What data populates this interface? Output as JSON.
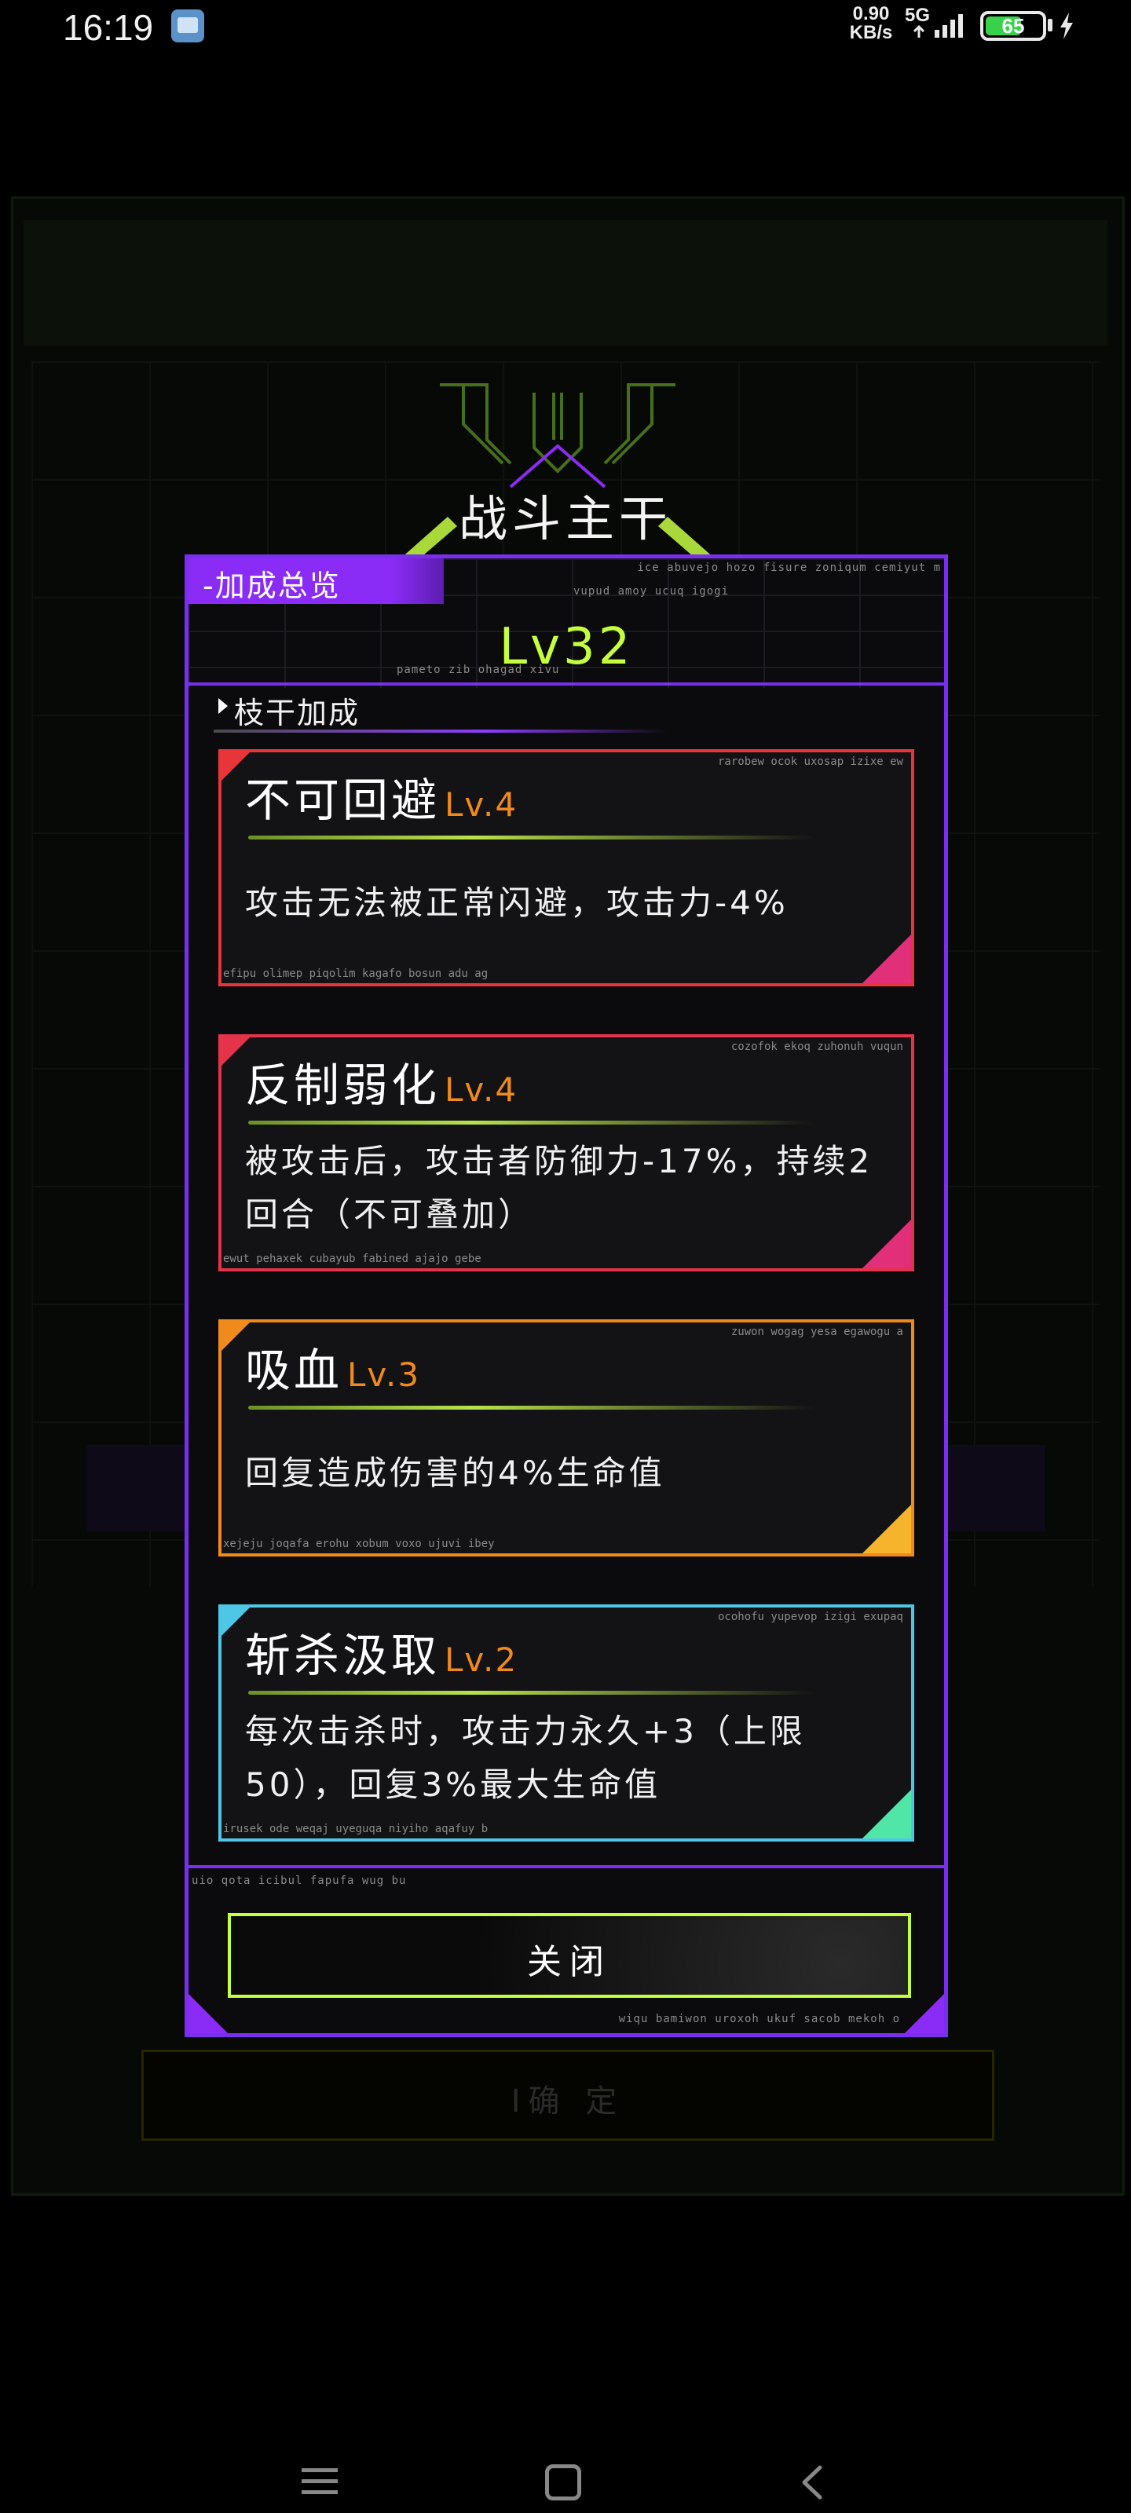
{
  "status_bar": {
    "time": "16:19",
    "net_speed_value": "0.90",
    "net_speed_unit": "KB/s",
    "network_type": "5G",
    "battery_level": "65",
    "battery_fraction": 0.65
  },
  "dialog": {
    "title": "战斗主干",
    "header_tag": "-加成总览",
    "level": "Lv32",
    "section_title": "枝干加成",
    "close_label": "关闭",
    "noise": {
      "top_right": "ice abuvejo hozo fisure zoniqum cemiyut m",
      "top_mid": "vupud amoy ucuq igogi",
      "level_under": "pameto zib ohagad xivu",
      "above_close": "uio qota icibul fapufa wug bu",
      "bottom_right": "wiqu bamiwon uroxoh ukuf sacob mekoh o"
    }
  },
  "skills": [
    {
      "name": "不可回避",
      "level": "Lv.4",
      "description": "攻击无法被正常闪避，攻击力-4%",
      "noise_top": "rarobew ocok uxosap izixe ew",
      "noise_bottom": "efipu olimep piqolim kagafo bosun adu ag",
      "border_color": "#e8353a",
      "corner_color": "#e12f7a"
    },
    {
      "name": "反制弱化",
      "level": "Lv.4",
      "description": "被攻击后，攻击者防御力-17%，持续2回合（不可叠加）",
      "noise_top": "cozofok ekoq zuhonuh vuqun",
      "noise_bottom": "ewut pehaxek cubayub fabined ajajo gebe",
      "border_color": "#e5334b",
      "corner_color": "#e12f7a"
    },
    {
      "name": "吸血",
      "level": "Lv.3",
      "description": "回复造成伤害的4%生命值",
      "noise_top": "zuwon wogag yesa egawogu a",
      "noise_bottom": "xejeju joqafa erohu xobum voxo ujuvi ibey",
      "border_color": "#f08a1c",
      "corner_color": "#f6b42c"
    },
    {
      "name": "斩杀汲取",
      "level": "Lv.2",
      "description": "每次击杀时，攻击力永久+3（上限50），回复3%最大生命值",
      "noise_top": "ocohofu yupevop izigi exupaq",
      "noise_bottom": "irusek ode weqaj uyeguqa niyiho aqafuy b",
      "border_color": "#4ec6e6",
      "corner_color": "#4fe6a8"
    }
  ],
  "background": {
    "button_label": "Ι确 定"
  },
  "nav_bar": {
    "menu_icon": "menu-icon",
    "home_icon": "home-icon",
    "back_icon": "back-icon"
  }
}
